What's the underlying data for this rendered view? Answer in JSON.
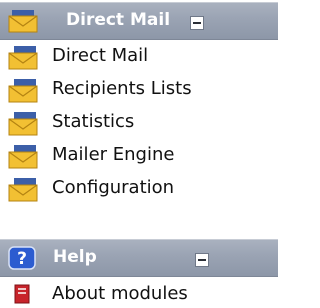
{
  "direct_mail_section": {
    "title": "Direct Mail",
    "items": [
      {
        "label": "Direct Mail",
        "icon": "mail-envelope-icon"
      },
      {
        "label": "Recipients Lists",
        "icon": "mail-envelope-icon"
      },
      {
        "label": "Statistics",
        "icon": "mail-envelope-icon"
      },
      {
        "label": "Mailer Engine",
        "icon": "mail-envelope-icon"
      },
      {
        "label": "Configuration",
        "icon": "mail-envelope-icon"
      }
    ]
  },
  "help_section": {
    "title": "Help",
    "items": [
      {
        "label": "About modules",
        "icon": "red-book-icon"
      }
    ]
  },
  "colors": {
    "header_bg": "#9aa3b3",
    "envelope_yellow": "#f2c033",
    "envelope_blue": "#3c5fa8",
    "help_icon_blue": "#2c5cd0",
    "about_icon_red": "#c8242b"
  }
}
